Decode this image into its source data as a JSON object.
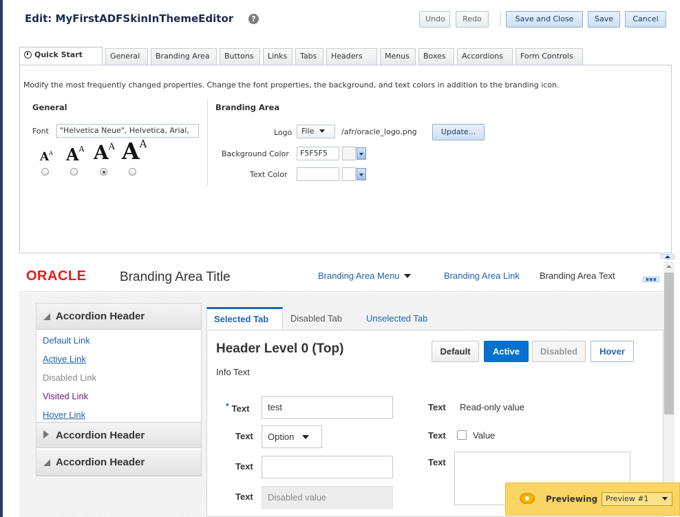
{
  "header": {
    "title": "Edit: MyFirstADFSkinInThemeEditor",
    "help_glyph": "?",
    "buttons": {
      "undo": "Undo",
      "redo": "Redo",
      "save_close": "Save and Close",
      "save": "Save",
      "cancel": "Cancel"
    }
  },
  "tabs": [
    "Quick Start",
    "General",
    "Branding Area",
    "Buttons",
    "Links",
    "Tabs",
    "Headers",
    "Menus",
    "Boxes",
    "Accordions",
    "Form Controls"
  ],
  "description": "Modify the most frequently changed properties. Change the font properties, the background, and text colors in addition to the branding icon.",
  "general": {
    "title": "General",
    "font_label": "Font",
    "font_value": "\"Helvetica Neue\", Helvetica, Arial,",
    "size_glyph": "A",
    "size_sup": "A",
    "selected_size_index": 2
  },
  "branding": {
    "title": "Branding Area",
    "logo_label": "Logo",
    "logo_type": "File",
    "logo_path": "/afr/oracle_logo.png",
    "update_label": "Update...",
    "bg_label": "Background Color",
    "bg_value": "F5F5F5",
    "text_color_label": "Text Color",
    "text_color_value": ""
  },
  "preview": {
    "logo_text": "ORACLE",
    "title": "Branding Area Title",
    "menu": "Branding Area Menu",
    "link": "Branding Area Link",
    "text": "Branding Area Text",
    "more_glyph": "▪▪▪",
    "accordion": {
      "headers": [
        "Accordion Header",
        "Accordion Header",
        "Accordion Header"
      ],
      "links": [
        "Default Link",
        "Active Link",
        "Disabled Link",
        "Visited Link",
        "Hover Link"
      ]
    },
    "tabs": [
      "Selected Tab",
      "Disabled Tab",
      "Unselected Tab"
    ],
    "header_level": "Header Level 0 (Top)",
    "info_text": "Info Text",
    "buttons": [
      "Default",
      "Active",
      "Disabled",
      "Hover"
    ],
    "form": {
      "label": "Text",
      "required_mark": "*",
      "input_value": "test",
      "select_value": "Option",
      "disabled_value": "Disabled value",
      "readonly_value": "Read-only value",
      "checkbox_label": "Value"
    }
  },
  "banner": {
    "label": "Previewing",
    "select_value": "Preview #1"
  },
  "colors": {
    "oracle_red": "#e01d1d",
    "link_blue": "#1d64b0",
    "active_button": "#0572ce",
    "visited_link": "#6b1a8a",
    "banner_yellow": "#fbd563"
  }
}
